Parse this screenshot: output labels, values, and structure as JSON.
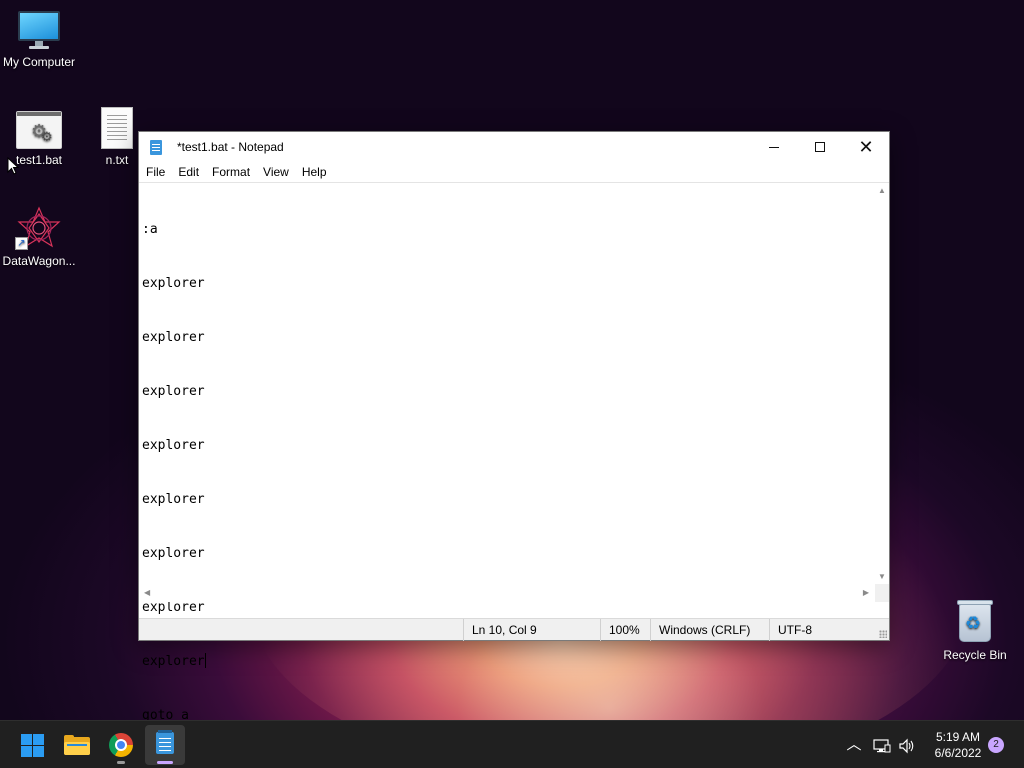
{
  "desktop": {
    "icons": [
      {
        "label": "My Computer",
        "icon": "monitor-icon"
      },
      {
        "label": "test1.bat",
        "icon": "batch-file-icon"
      },
      {
        "label": "n.txt",
        "icon": "text-file-icon"
      },
      {
        "label": "DataWagon...",
        "icon": "datawagon-shortcut-icon"
      },
      {
        "label": "Recycle Bin",
        "icon": "recycle-bin-icon"
      }
    ]
  },
  "notepad": {
    "title": "*test1.bat - Notepad",
    "menu": [
      "File",
      "Edit",
      "Format",
      "View",
      "Help"
    ],
    "lines": [
      ":a",
      "explorer",
      "explorer",
      "explorer",
      "explorer",
      "explorer",
      "explorer",
      "explorer",
      "explorer",
      "explorer",
      "goto a"
    ],
    "status": {
      "position": "Ln 10, Col 9",
      "zoom": "100%",
      "line_ending": "Windows (CRLF)",
      "encoding": "UTF-8"
    }
  },
  "taskbar": {
    "apps": [
      "windows-start-icon",
      "file-explorer-icon",
      "chrome-icon",
      "notepad-icon"
    ],
    "tray": [
      "chevron-up-icon",
      "network-icon",
      "volume-icon"
    ],
    "time": "5:19 AM",
    "date": "6/6/2022",
    "notifications": "2"
  },
  "colors": {
    "accent": "#c9a6ff",
    "taskbar": "#202020",
    "start": "#2b9cf2"
  }
}
